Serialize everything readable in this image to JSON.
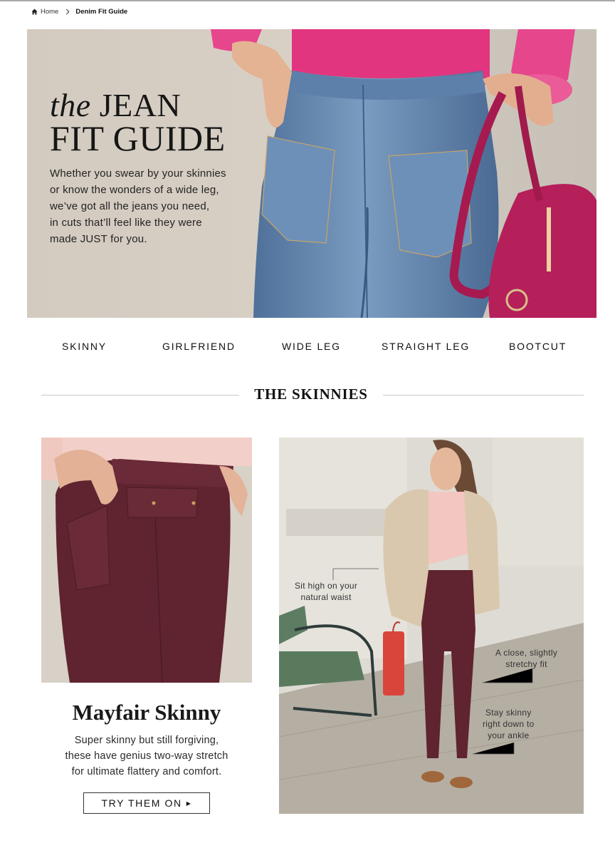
{
  "breadcrumb": {
    "home_label": "Home",
    "current_label": "Denim Fit Guide"
  },
  "hero": {
    "title_the": "the",
    "title_jean": "JEAN",
    "title_line2": "FIT GUIDE",
    "text_lines": [
      "Whether you swear by your skinnies",
      "or know the wonders of a wide leg,",
      "we’ve got all the jeans you need,",
      "in cuts that’ll feel like they were",
      "made JUST for you."
    ]
  },
  "fit_nav": [
    "SKINNY",
    "GIRLFRIEND",
    "WIDE LEG",
    "STRAIGHT LEG",
    "BOOTCUT"
  ],
  "section": {
    "title": "THE SKINNIES"
  },
  "product": {
    "name": "Mayfair Skinny",
    "desc_lines": [
      "Super skinny but still forgiving,",
      "these have genius two-way stretch",
      "for ultimate flattery and comfort."
    ],
    "cta_label": "TRY THEM ON"
  },
  "annotations": {
    "waist": [
      "Sit high on your",
      "natural waist"
    ],
    "fit": [
      "A close, slightly",
      "stretchy fit"
    ],
    "ankle": [
      "Stay skinny",
      "right down to",
      "your ankle"
    ]
  },
  "colors": {
    "denim": "#6a8fb6",
    "sweater_pink": "#e2357f",
    "bag_magenta": "#b51f5a",
    "burgundy": "#5f2430",
    "blush": "#f2cfc8"
  }
}
